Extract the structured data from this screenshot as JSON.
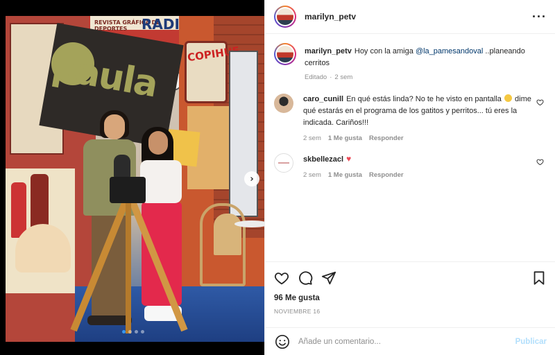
{
  "post": {
    "username": "marilyn_petv",
    "caption_user": "marilyn_petv",
    "caption_text": "Hoy con la amiga",
    "caption_mention": "@la_pamesandoval",
    "caption_rest": "..planeando cerritos",
    "edited": "Editado",
    "edited_time": "2 sem",
    "likes": "96 Me gusta",
    "date": "NOVIEMBRE 16",
    "photo_signs": {
      "board": "paula",
      "radio": "RADIO",
      "revista": "REVISTA GRÁFICA DE DEPORTES",
      "copihue": "COPIHUE"
    }
  },
  "comments": [
    {
      "user": "caro_cunill",
      "text_before": "En qué estás linda? No te he visto en pantalla",
      "text_after": "dime qué estarás en el programa de los gatitos y perritos... tú eres la indicada. Cariños!!!",
      "time": "2 sem",
      "likes": "1 Me gusta",
      "reply": "Responder"
    },
    {
      "user": "skbellezacl",
      "text": "",
      "time": "2 sem",
      "likes": "1 Me gusta",
      "reply": "Responder"
    }
  ],
  "composer": {
    "placeholder": "Añade un comentario...",
    "publish": "Publicar"
  },
  "carousel": {
    "slides": 4,
    "active": 0
  },
  "icons": {
    "more": "more-options-icon",
    "like": "heart-icon",
    "comment": "comment-icon",
    "share": "paper-plane-icon",
    "save": "bookmark-icon",
    "emoji": "smiley-icon",
    "next": "chevron-right-icon"
  },
  "colors": {
    "link": "#00376b",
    "publish_disabled": "#b2dffc",
    "carousel_active": "#3897f0"
  }
}
